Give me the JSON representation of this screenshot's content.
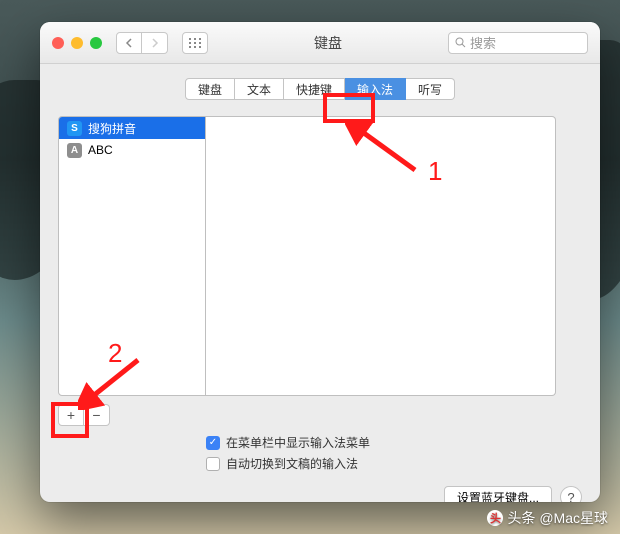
{
  "window": {
    "title": "键盘",
    "search_placeholder": "搜索"
  },
  "tabs": [
    {
      "label": "键盘",
      "active": false
    },
    {
      "label": "文本",
      "active": false
    },
    {
      "label": "快捷键",
      "active": false
    },
    {
      "label": "输入法",
      "active": true
    },
    {
      "label": "听写",
      "active": false
    }
  ],
  "input_sources": [
    {
      "label": "搜狗拼音",
      "icon": "S",
      "icon_color": "blue",
      "selected": true
    },
    {
      "label": "ABC",
      "icon": "A",
      "icon_color": "gray",
      "selected": false
    }
  ],
  "buttons": {
    "add": "+",
    "remove": "−",
    "bluetooth": "设置蓝牙键盘...",
    "help": "?"
  },
  "checkboxes": {
    "show_in_menubar": {
      "label": "在菜单栏中显示输入法菜单",
      "checked": true
    },
    "auto_switch": {
      "label": "自动切换到文稿的输入法",
      "checked": false
    }
  },
  "annotations": {
    "label1": "1",
    "label2": "2"
  },
  "watermark": "头条 @Mac星球"
}
